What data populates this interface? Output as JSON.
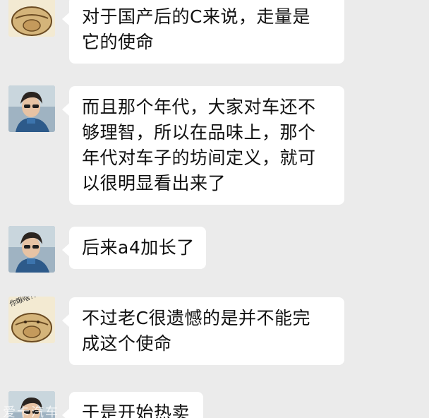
{
  "conversation": {
    "messages": [
      {
        "sender": "cat",
        "lines": [
          "对于国产后的C来说，走量是",
          "它的使命"
        ]
      },
      {
        "sender": "person",
        "lines": [
          "而且那个年代，大家对车还不",
          "够理智，所以在品味上，那个",
          "年代对车子的坊间定义，就可",
          "以很明显看出来了"
        ]
      },
      {
        "sender": "person",
        "lines": [
          "后来a4加长了"
        ]
      },
      {
        "sender": "cat",
        "lines": [
          "不过老C很遗憾的是并不能完",
          "成这个使命"
        ]
      },
      {
        "sender": "person",
        "lines": [
          "于是开始热卖"
        ]
      }
    ],
    "avatar_caption": "你瞅啥?!",
    "watermark": "爱卡汽车"
  },
  "colors": {
    "background": "#ebebeb",
    "bubble": "#ffffff",
    "text": "#111111"
  }
}
